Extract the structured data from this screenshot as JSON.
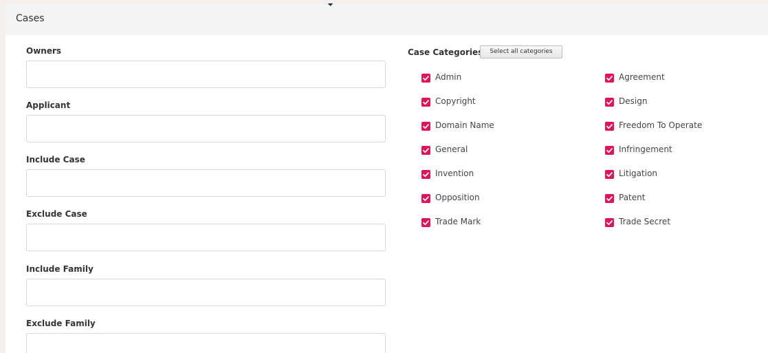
{
  "panel": {
    "title": "Cases"
  },
  "fields": [
    {
      "label": "Owners",
      "value": "",
      "placeholder": ""
    },
    {
      "label": "Applicant",
      "value": "",
      "placeholder": ""
    },
    {
      "label": "Include Case",
      "value": "",
      "placeholder": ""
    },
    {
      "label": "Exclude Case",
      "value": "",
      "placeholder": ""
    },
    {
      "label": "Include Family",
      "value": "",
      "placeholder": ""
    },
    {
      "label": "Exclude Family",
      "value": "",
      "placeholder": ""
    }
  ],
  "categories": {
    "title": "Case Categories",
    "select_all_label": "Select all categories",
    "check_color": "#e0135b",
    "left": [
      {
        "label": "Admin",
        "checked": true
      },
      {
        "label": "Copyright",
        "checked": true
      },
      {
        "label": "Domain Name",
        "checked": true
      },
      {
        "label": "General",
        "checked": true
      },
      {
        "label": "Invention",
        "checked": true
      },
      {
        "label": "Opposition",
        "checked": true
      },
      {
        "label": "Trade Mark",
        "checked": true
      }
    ],
    "right": [
      {
        "label": "Agreement",
        "checked": true
      },
      {
        "label": "Design",
        "checked": true
      },
      {
        "label": "Freedom To Operate",
        "checked": true
      },
      {
        "label": "Infringement",
        "checked": true
      },
      {
        "label": "Litigation",
        "checked": true
      },
      {
        "label": "Patent",
        "checked": true
      },
      {
        "label": "Trade Secret",
        "checked": true
      }
    ]
  }
}
